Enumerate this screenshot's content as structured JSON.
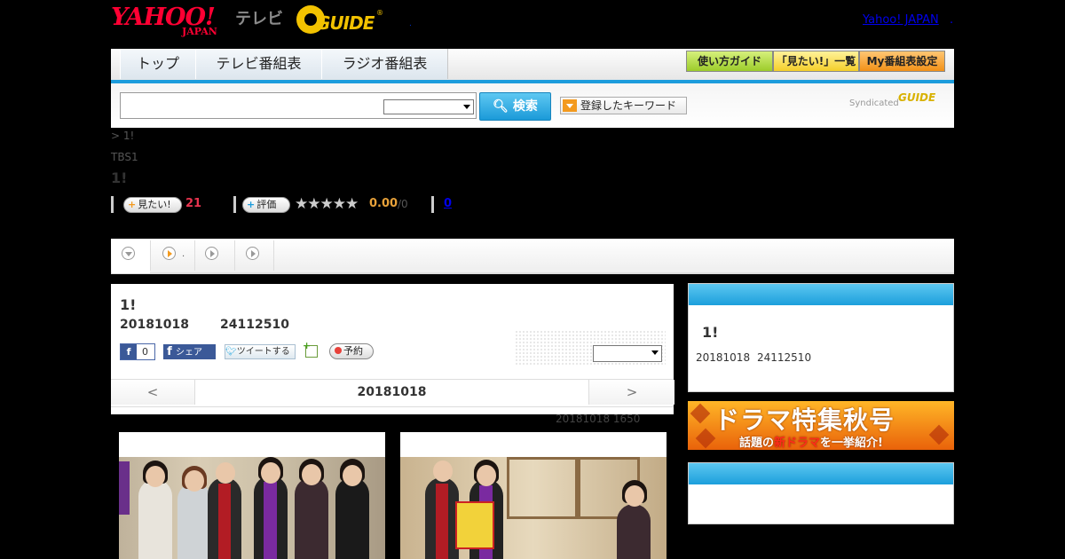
{
  "header": {
    "logo_yahoo": "YAHOO!",
    "logo_japan": "JAPAN",
    "logo_tv": "テレビ",
    "logo_gguide": "GUIDE",
    "dot": ".",
    "yahoo_link": "Yahoo! JAPAN",
    "yahoo_link_sep": "."
  },
  "nav": {
    "tabs": [
      "トップ",
      "テレビ番組表",
      "ラジオ番組表"
    ],
    "right_buttons": [
      "使い方ガイド",
      "「見たい!」一覧",
      "My番組表設定"
    ]
  },
  "search": {
    "query": "",
    "button_label": "検索",
    "keyword_label": "登録したキーワード",
    "syndicated": "Syndicated",
    "syndicated_logo": "GUIDE"
  },
  "program": {
    "breadcrumb": "> 1!",
    "channel": "TBS1",
    "title": "1!",
    "mitai_label": "見たい!",
    "mitai_count": "21",
    "rating_label": "評価",
    "stars": "★★★★★",
    "rating_value": "0.00",
    "rating_max": "/0",
    "comment_count": "0"
  },
  "tabs": {
    "tab2_suffix": "."
  },
  "main": {
    "title": "1!",
    "date": "20181018",
    "time": "24112510",
    "fb_like_count": "0",
    "fb_share_label": "シェア",
    "tweet_label": "ツイートする",
    "reserve_label": "予約",
    "date_prev": "<",
    "date_label": "20181018",
    "date_next": ">",
    "update_text": "20181018  1650"
  },
  "side": {
    "title": "1!",
    "date": "20181018",
    "time": "24112510",
    "banner_line1": "ドラマ特集秋号",
    "banner_line2_a": "話題の",
    "banner_line2_red": "新ドラマ",
    "banner_line2_b": "を一挙紹介!"
  },
  "colors": {
    "accent_blue": "#1c9cdc",
    "mitai_pink": "#e8344f",
    "rating_orange": "#e8a23a"
  }
}
